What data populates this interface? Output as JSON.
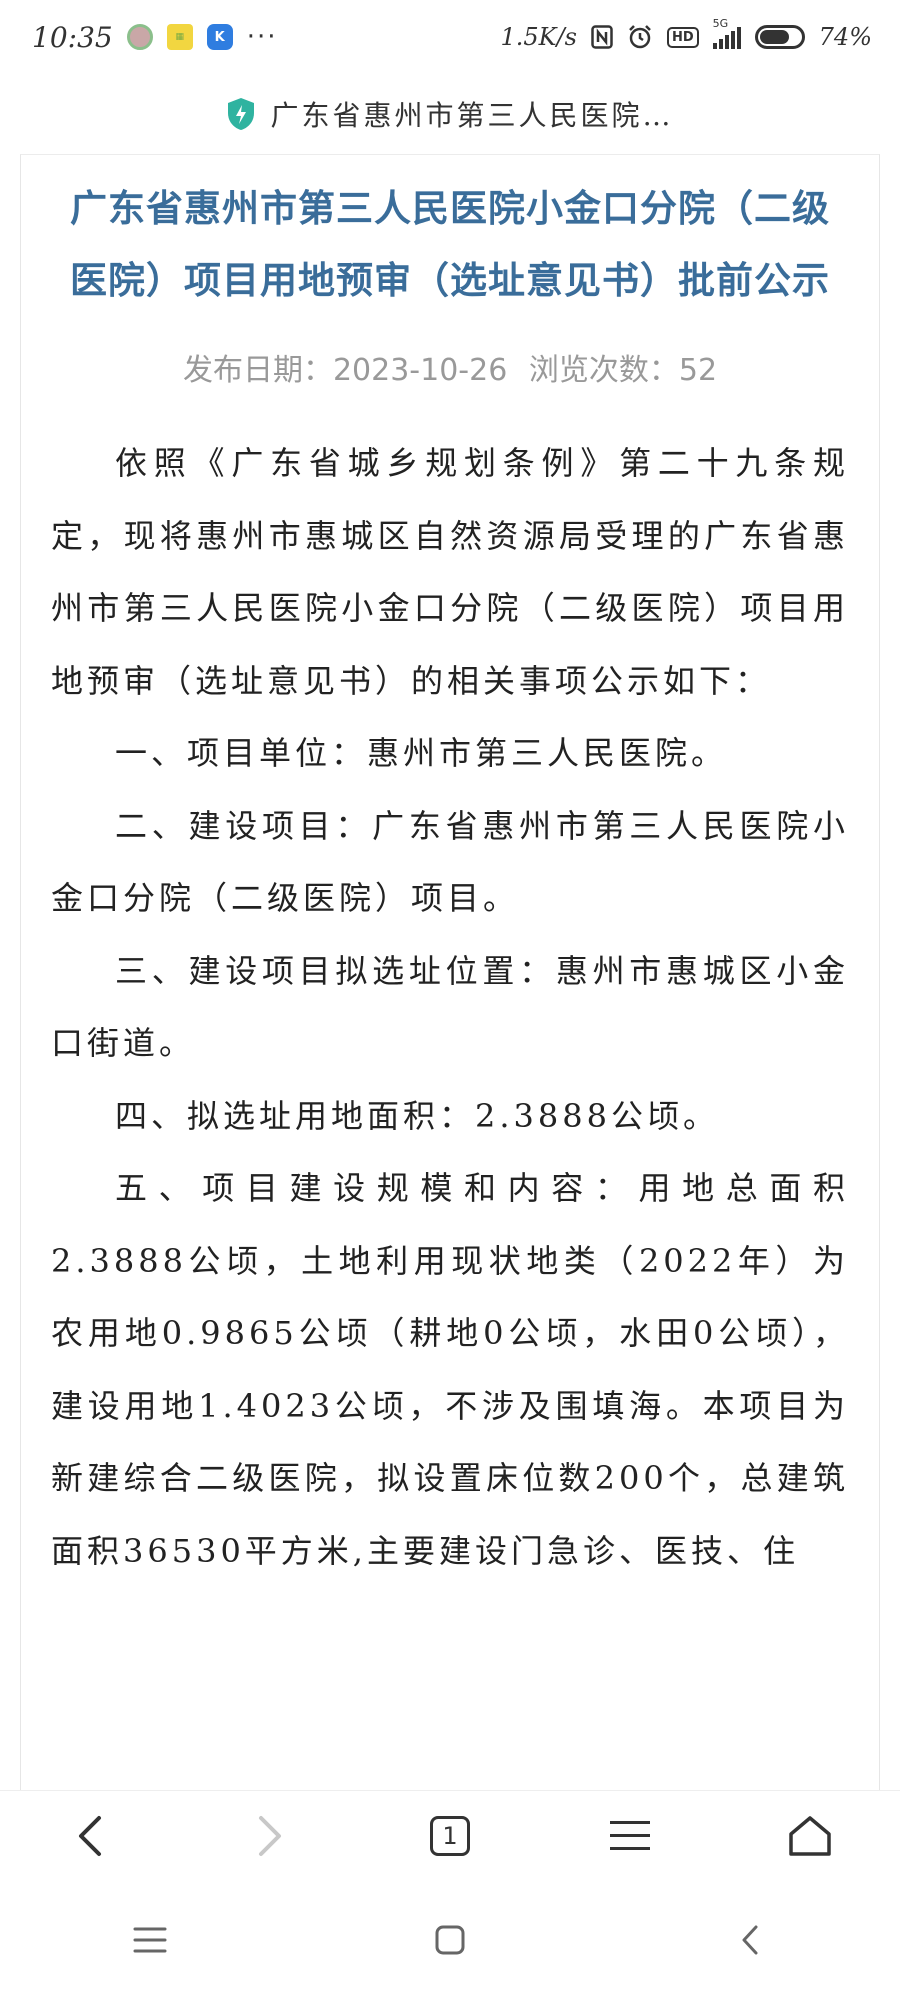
{
  "status_bar": {
    "time": "10:35",
    "dots": "···",
    "net_speed": "1.5K/s",
    "hd": "HD",
    "network": "5G",
    "battery": "74%",
    "battery_level": 0.74,
    "icons": [
      "nfc-icon",
      "alarm-icon",
      "hd-icon",
      "signal-icon",
      "battery-icon"
    ]
  },
  "url_bar": {
    "title": "广东省惠州市第三人民医院…",
    "secure_icon": "shield-icon"
  },
  "article": {
    "title": "广东省惠州市第三人民医院小金口分院（二级医院）项目用地预审（选址意见书）批前公示",
    "publish_date": "发布日期：2023-10-26",
    "view_count": "浏览次数：52",
    "paragraphs": [
      "依照《广东省城乡规划条例》第二十九条规定，现将惠州市惠城区自然资源局受理的广东省惠州市第三人民医院小金口分院（二级医院）项目用地预审（选址意见书）的相关事项公示如下：",
      "一、项目单位：惠州市第三人民医院。",
      "二、建设项目：广东省惠州市第三人民医院小金口分院（二级医院）项目。",
      "三、建设项目拟选址位置：惠州市惠城区小金口街道。",
      "四、拟选址用地面积：2.3888公顷。",
      "五、项目建设规模和内容：用地总面积2.3888公顷，土地利用现状地类（2022年）为农用地0.9865公顷（耕地0公顷，水田0公顷），建设用地1.4023公顷，不涉及围填海。本项目为新建综合二级医院，拟设置床位数200个，总建筑面积36530平方米,主要建设门急诊、医技、住"
    ]
  },
  "browser_toolbar": {
    "back_icon": "back-icon",
    "forward_icon": "forward-icon",
    "tab_count": "1",
    "menu_icon": "menu-icon",
    "home_icon": "home-icon"
  },
  "system_nav": {
    "icons": [
      "recent-apps-icon",
      "home-icon",
      "back-icon"
    ]
  }
}
